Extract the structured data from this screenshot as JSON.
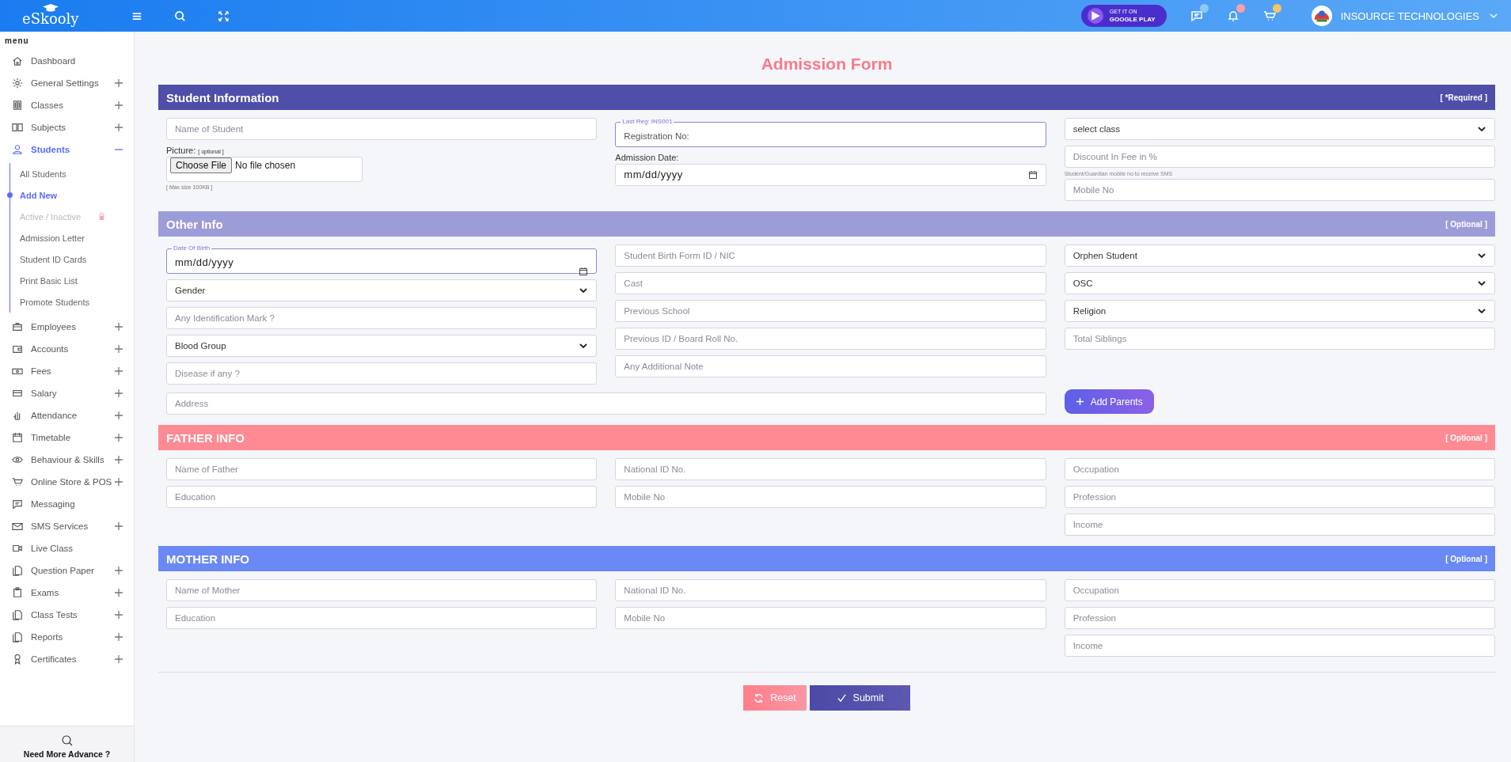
{
  "topbar": {
    "logo": "eSkooly",
    "store_badge": {
      "small": "GET IT ON",
      "large": "GOOGLE PLAY"
    },
    "notifications": [
      {
        "color": "#8ec9f3"
      },
      {
        "color": "#f7a1ac"
      },
      {
        "color": "#f6c469"
      }
    ],
    "account": "INSOURCE TECHNOLOGIES"
  },
  "sidebar": {
    "heading": "menu",
    "items": [
      {
        "label": "Dashboard",
        "selected": false
      },
      {
        "label": "General Settings",
        "expandable": true,
        "expanded": false,
        "selected": false
      },
      {
        "label": "Classes",
        "expandable": true,
        "expanded": false,
        "selected": false
      },
      {
        "label": "Subjects",
        "expandable": true,
        "expanded": false,
        "selected": false
      },
      {
        "label": "Students",
        "expandable": true,
        "expanded": true,
        "selected": true,
        "children": [
          {
            "label": "All Students",
            "selected": false,
            "locked": false
          },
          {
            "label": "Add New",
            "selected": true,
            "locked": false
          },
          {
            "label": "Active / Inactive",
            "selected": false,
            "locked": true
          },
          {
            "label": "Admission Letter",
            "selected": false,
            "locked": false
          },
          {
            "label": "Student ID Cards",
            "selected": false,
            "locked": false
          },
          {
            "label": "Print Basic List",
            "selected": false,
            "locked": false
          },
          {
            "label": "Promote Students",
            "selected": false,
            "locked": false
          }
        ]
      },
      {
        "label": "Employees",
        "expandable": true,
        "expanded": false,
        "selected": false
      },
      {
        "label": "Accounts",
        "expandable": true,
        "expanded": false,
        "selected": false
      },
      {
        "label": "Fees",
        "expandable": true,
        "expanded": false,
        "selected": false
      },
      {
        "label": "Salary",
        "expandable": true,
        "expanded": false,
        "selected": false
      },
      {
        "label": "Attendance",
        "expandable": true,
        "expanded": false,
        "selected": false
      },
      {
        "label": "Timetable",
        "expandable": true,
        "expanded": false,
        "selected": false
      },
      {
        "label": "Behaviour & Skills",
        "expandable": true,
        "expanded": false,
        "selected": false
      },
      {
        "label": "Online Store & POS",
        "expandable": true,
        "expanded": false,
        "selected": false
      },
      {
        "label": "Messaging",
        "selected": false
      },
      {
        "label": "SMS Services",
        "expandable": true,
        "expanded": false,
        "selected": false
      },
      {
        "label": "Live Class",
        "selected": false
      },
      {
        "label": "Question Paper",
        "expandable": true,
        "expanded": false,
        "selected": false
      },
      {
        "label": "Exams",
        "expandable": true,
        "expanded": false,
        "selected": false
      },
      {
        "label": "Class Tests",
        "expandable": true,
        "expanded": false,
        "selected": false
      },
      {
        "label": "Reports",
        "expandable": true,
        "expanded": false,
        "selected": false
      },
      {
        "label": "Certificates",
        "expandable": true,
        "expanded": false,
        "selected": false
      }
    ],
    "help": "Need More Advance ?"
  },
  "page_title": "Admission Form",
  "sections": [
    {
      "title": "Student Information",
      "note": "[ *Required ]",
      "color": "#4f4ea8",
      "columns": [
        [
          {
            "kind": "text",
            "placeholder": "Name of Student"
          },
          {
            "kind": "file",
            "label": "Picture:",
            "label_note": "[ optional ]",
            "button": "Choose File",
            "value": "No file chosen",
            "hint": "[ Max size 100KB ]"
          }
        ],
        [
          {
            "kind": "text",
            "legend": "Last Reg: INS001",
            "placeholder": "Registration No:"
          },
          {
            "kind": "date",
            "label": "Admission Date:",
            "value": "mm/dd/yyyy"
          }
        ],
        [
          {
            "kind": "select",
            "value": "select class"
          },
          {
            "kind": "text",
            "placeholder": "Discount In Fee in %"
          },
          {
            "kind": "text",
            "caption": "Student/Guardian mobile no to receive SMS",
            "placeholder": "Mobile No"
          }
        ]
      ]
    },
    {
      "title": "Other Info",
      "note": "[ Optional ]",
      "color": "#9d9cd9",
      "columns": [
        [
          {
            "kind": "date",
            "legend": "Date Of Birth",
            "value": "mm/dd/yyyy"
          },
          {
            "kind": "select",
            "value": "Gender"
          },
          {
            "kind": "text",
            "placeholder": "Any Identification Mark ?"
          },
          {
            "kind": "select",
            "value": "Blood Group"
          },
          {
            "kind": "text",
            "placeholder": "Disease if any ?"
          }
        ],
        [
          {
            "kind": "text",
            "placeholder": "Student Birth Form ID / NIC"
          },
          {
            "kind": "text",
            "placeholder": "Cast"
          },
          {
            "kind": "text",
            "placeholder": "Previous School"
          },
          {
            "kind": "text",
            "placeholder": "Previous ID / Board Roll No."
          },
          {
            "kind": "text",
            "placeholder": "Any Additional Note"
          }
        ],
        [
          {
            "kind": "select",
            "value": "Orphen Student"
          },
          {
            "kind": "select",
            "value": "OSC"
          },
          {
            "kind": "select",
            "value": "Religion"
          },
          {
            "kind": "text",
            "placeholder": "Total Siblings"
          }
        ]
      ],
      "address": {
        "placeholder": "Address"
      },
      "action": "Add Parents"
    },
    {
      "title": "FATHER INFO",
      "note": "[ Optional ]",
      "color": "#fe8a93",
      "columns": [
        [
          {
            "kind": "text",
            "placeholder": "Name of Father"
          },
          {
            "kind": "text",
            "placeholder": "Education"
          }
        ],
        [
          {
            "kind": "text",
            "placeholder": "National ID No."
          },
          {
            "kind": "text",
            "placeholder": "Mobile No"
          }
        ],
        [
          {
            "kind": "text",
            "placeholder": "Occupation"
          },
          {
            "kind": "text",
            "placeholder": "Profession"
          },
          {
            "kind": "text",
            "placeholder": "Income"
          }
        ]
      ]
    },
    {
      "title": "MOTHER INFO",
      "note": "[ Optional ]",
      "color": "#6b89f5",
      "columns": [
        [
          {
            "kind": "text",
            "placeholder": "Name of Mother"
          },
          {
            "kind": "text",
            "placeholder": "Education"
          }
        ],
        [
          {
            "kind": "text",
            "placeholder": "National ID No."
          },
          {
            "kind": "text",
            "placeholder": "Mobile No"
          }
        ],
        [
          {
            "kind": "text",
            "placeholder": "Occupation"
          },
          {
            "kind": "text",
            "placeholder": "Profession"
          },
          {
            "kind": "text",
            "placeholder": "Income"
          }
        ]
      ]
    }
  ],
  "buttons": [
    {
      "label": "Reset",
      "kind": "reset"
    },
    {
      "label": "Submit",
      "kind": "submit"
    }
  ]
}
